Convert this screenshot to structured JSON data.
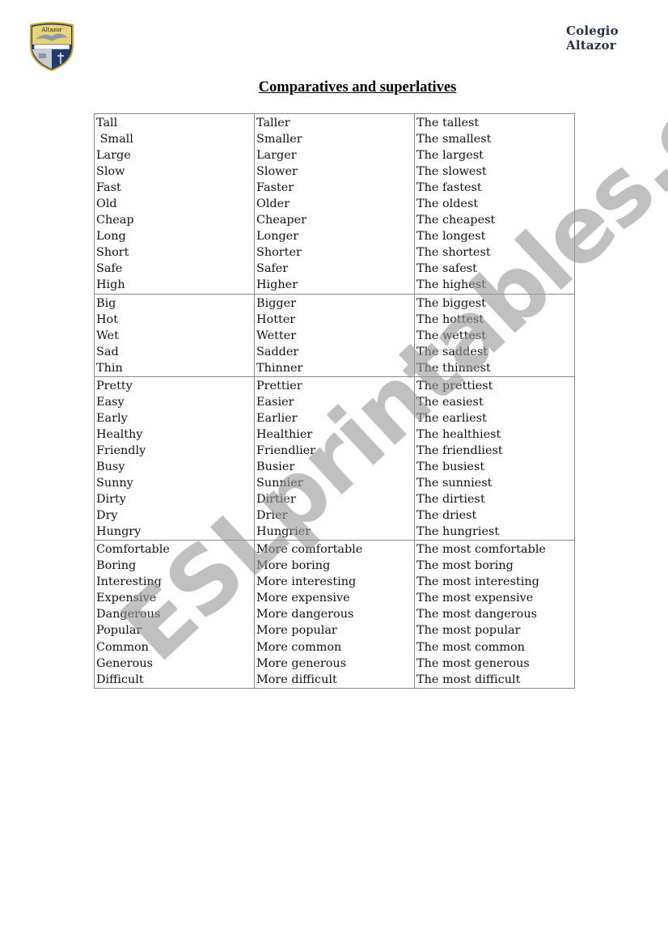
{
  "header": {
    "logo_icon": "school-crest-icon",
    "logo_text": "Altazor",
    "school_name": "Colegio Altazor"
  },
  "title": "Comparatives and superlatives",
  "groups": [
    {
      "rows": [
        [
          "Tall",
          "Taller",
          "The tallest"
        ],
        [
          " Small",
          "Smaller",
          "The smallest"
        ],
        [
          "Large",
          "Larger",
          "The largest"
        ],
        [
          "Slow",
          "Slower",
          "The slowest"
        ],
        [
          "Fast",
          "Faster",
          "The fastest"
        ],
        [
          "Old",
          "Older",
          "The oldest"
        ],
        [
          "Cheap",
          "Cheaper",
          "The cheapest"
        ],
        [
          "Long",
          "Longer",
          "The longest"
        ],
        [
          "Short",
          "Shorter",
          "The shortest"
        ],
        [
          "Safe",
          "Safer",
          "The safest"
        ],
        [
          "High",
          "Higher",
          "The highest"
        ]
      ]
    },
    {
      "rows": [
        [
          "Big",
          "Bigger",
          "The biggest"
        ],
        [
          "Hot",
          "Hotter",
          "The hottest"
        ],
        [
          "Wet",
          "Wetter",
          "The wettest"
        ],
        [
          "Sad",
          "Sadder",
          "The saddest"
        ],
        [
          "Thin",
          "Thinner",
          "The thinnest"
        ]
      ]
    },
    {
      "rows": [
        [
          "Pretty",
          "Prettier",
          "The prettiest"
        ],
        [
          "Easy",
          "Easier",
          "The easiest"
        ],
        [
          "Early",
          "Earlier",
          "The earliest"
        ],
        [
          "Healthy",
          "Healthier",
          "The healthiest"
        ],
        [
          "Friendly",
          "Friendlier",
          "The friendliest"
        ],
        [
          "Busy",
          "Busier",
          "The busiest"
        ],
        [
          "Sunny",
          "Sunnier",
          "The sunniest"
        ],
        [
          "Dirty",
          "Dirtier",
          "The dirtiest"
        ],
        [
          "Dry",
          "Drier",
          "The driest"
        ],
        [
          "Hungry",
          "Hungrier",
          "The hungriest"
        ]
      ]
    },
    {
      "rows": [
        [
          "Comfortable",
          "More comfortable",
          "The most comfortable"
        ],
        [
          "Boring",
          "More boring",
          "The most boring"
        ],
        [
          "Interesting",
          "More interesting",
          "The most interesting"
        ],
        [
          "Expensive",
          "More expensive",
          "The most expensive"
        ],
        [
          "Dangerous",
          "More dangerous",
          "The most dangerous"
        ],
        [
          "Popular",
          "More popular",
          "The most popular"
        ],
        [
          "Common",
          "More common",
          "The most common"
        ],
        [
          "Generous",
          "More generous",
          "The most generous"
        ],
        [
          "Difficult",
          "More difficult",
          "The most difficult"
        ]
      ]
    }
  ],
  "watermark": "ESLprintables.com"
}
